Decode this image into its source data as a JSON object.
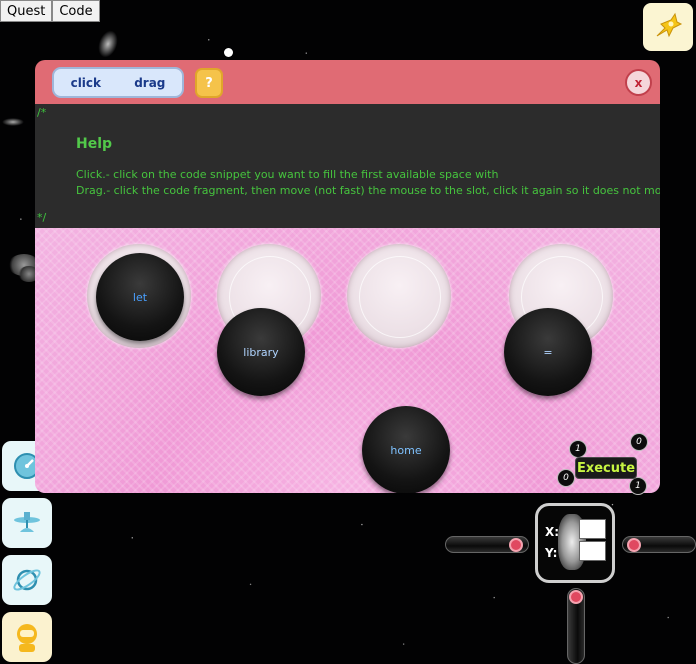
{
  "menu": {
    "items": [
      "Quest",
      "Code"
    ]
  },
  "toolbar": {
    "mode_click": "click",
    "mode_drag": "drag",
    "help_label": "?",
    "close_label": "x"
  },
  "help": {
    "comment_open": "/*",
    "title": "Help",
    "line1": "Click.- click on the code snippet you want to fill the first available space with",
    "line2": "Drag.- click the code fragment, then move (not fast) the mouse to the slot, click it again so it does not move",
    "comment_close": "*/"
  },
  "snippets": {
    "let": "let",
    "library": "library",
    "equals": "=",
    "home": "home"
  },
  "execute": {
    "label": "Execute",
    "badges": [
      "1",
      "0",
      "0",
      "1"
    ]
  },
  "robot": {
    "x_label": "X:",
    "y_label": "Y:"
  },
  "sidebar": {
    "icons": [
      "clock-icon",
      "satellite-icon",
      "planet-icon",
      "astronaut-icon"
    ]
  },
  "colors": {
    "header": "#e06b74",
    "help_text": "#46c43e",
    "execute_text": "#c8f542",
    "snippet_blue": "#4aa0ff",
    "snippet_text": "#b0d4ff"
  }
}
